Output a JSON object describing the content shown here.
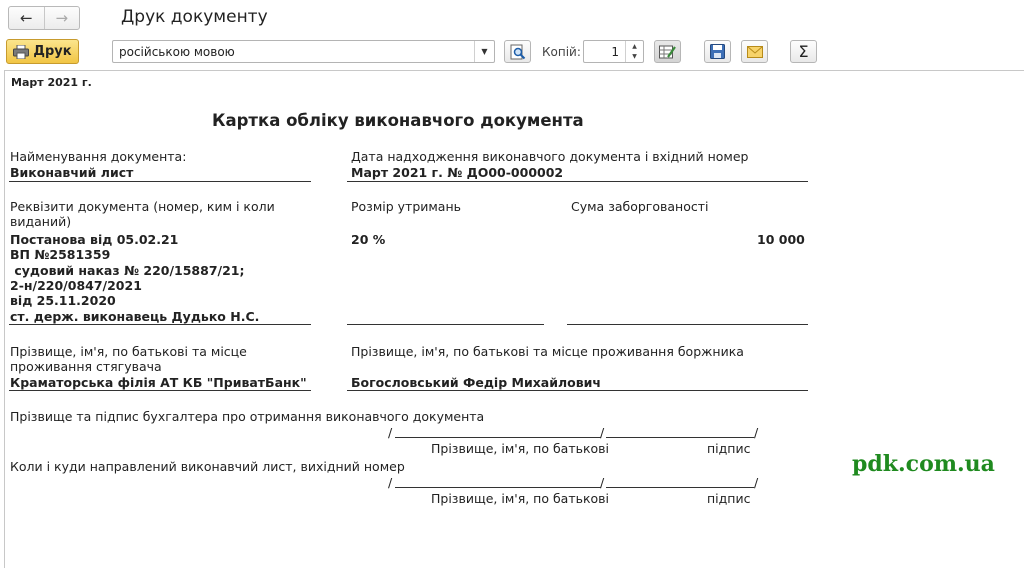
{
  "window": {
    "title": "Друк документу"
  },
  "toolbar": {
    "print_label": "Друк",
    "language_value": "російською мовою",
    "copies_label": "Копій:",
    "copies_value": "1"
  },
  "document": {
    "period": "Март 2021 г.",
    "title": "Картка обліку виконавчого документа",
    "doc_name_label": "Найменування документа:",
    "doc_name_value": "Виконавчий лист",
    "received_label": "Дата надходження виконавчого документа і вхідний номер",
    "received_value": "Март 2021 г. № ДО00-000002",
    "requisites_label_line1": "Реквізити документа (номер, ким і коли",
    "requisites_label_line2": "виданий)",
    "withholding_label": "Розмір утримань",
    "debt_label": "Сума заборгованості",
    "requisites_lines": [
      "Постанова від 05.02.21",
      "ВП №2581359",
      " судовий наказ № 220/15887/21;",
      "2-н/220/0847/2021",
      "від 25.11.2020",
      "ст. держ. виконавець Дудько Н.С."
    ],
    "withholding_value": "20 %",
    "debt_value": "10 000",
    "collector_label_line1": "Прізвище, ім'я, по батькові та місце",
    "collector_label_line2": "проживання стягувача",
    "collector_value": "Краматорська філія АТ КБ \"ПриватБанк\"",
    "debtor_label": "Прізвище, ім'я, по батькові та місце проживання боржника",
    "debtor_value": "Богословський Федір Михайлович",
    "accountant_label": "Прізвище та підпис бухгалтера про отримання виконавчого документа",
    "sent_label": "Коли і куди направлений виконавчий лист, вихідний номер",
    "slash": "/",
    "name_caption": "Прізвище, ім'я, по батькові",
    "sign_caption": "підпис"
  },
  "watermark": "pdk.com.ua",
  "colors": {
    "print_button": "#f1c544",
    "watermark": "#1f8a1f"
  },
  "icons": [
    "back-arrow-icon",
    "forward-arrow-icon",
    "printer-icon",
    "preview-search-icon",
    "edit-table-icon",
    "save-disk-icon",
    "email-envelope-icon",
    "sum-sigma-icon"
  ]
}
